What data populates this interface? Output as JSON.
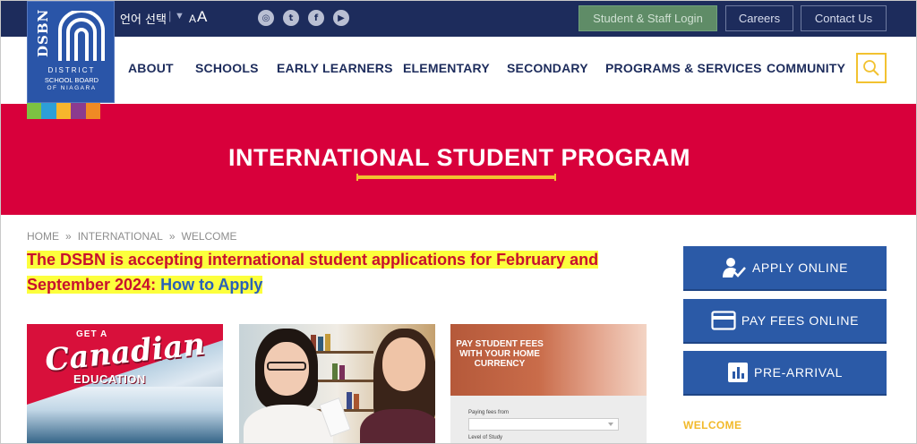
{
  "topbar": {
    "language_label": "언어 선택",
    "language_separator": "|",
    "font_small": "A",
    "font_large": "A",
    "social": [
      {
        "icon": "instagram-icon",
        "glyph": "◎"
      },
      {
        "icon": "twitter-icon",
        "glyph": "t"
      },
      {
        "icon": "facebook-icon",
        "glyph": "f"
      },
      {
        "icon": "youtube-icon",
        "glyph": "▶"
      }
    ],
    "login_label": "Student & Staff Login",
    "careers_label": "Careers",
    "contact_label": "Contact Us"
  },
  "logo": {
    "dsbn": "DSBN",
    "line1": "DISTRICT",
    "line2": "SCHOOL BOARD",
    "line3": "OF NIAGARA",
    "strip_colors": [
      "#7dc242",
      "#2d9fd8",
      "#f7b52c",
      "#8b3b8f",
      "#f08a24"
    ]
  },
  "nav": {
    "items": [
      "ABOUT",
      "SCHOOLS",
      "EARLY LEARNERS",
      "ELEMENTARY",
      "SECONDARY",
      "PROGRAMS & SERVICES",
      "COMMUNITY"
    ]
  },
  "banner": {
    "title": "INTERNATIONAL STUDENT PROGRAM"
  },
  "breadcrumb": {
    "items": [
      "HOME",
      "INTERNATIONAL",
      "WELCOME"
    ],
    "separator": "»"
  },
  "announcement": {
    "line1": "The DSBN is accepting international student applications for February and",
    "line2": "September 2024: ",
    "link": "How to Apply"
  },
  "cards": {
    "card1": {
      "get": "GET A",
      "title": "Canadian",
      "sub": "EDUCATION"
    },
    "card3": {
      "title_line1": "PAY STUDENT FEES",
      "title_line2": "WITH YOUR HOME",
      "title_line3": "CURRENCY",
      "label1": "Paying fees from",
      "label2": "Level of Study"
    }
  },
  "sidebar": {
    "apply": "APPLY ONLINE",
    "pay": "PAY FEES ONLINE",
    "pre": "PRE-ARRIVAL",
    "welcome": "WELCOME"
  },
  "colors": {
    "navy": "#1d2c5c",
    "banner_red": "#d8003b",
    "accent_yellow": "#f2c230",
    "button_blue": "#2b5aa7",
    "login_green": "#5f8c67"
  }
}
